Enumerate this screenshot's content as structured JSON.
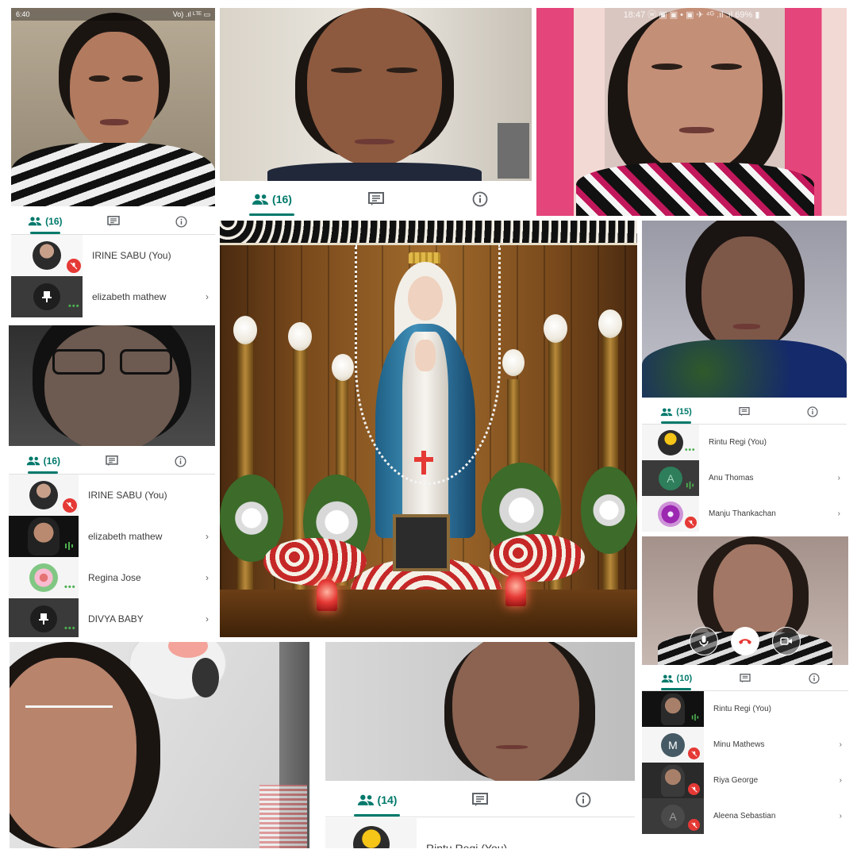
{
  "tile1": {
    "status_time": "6:40",
    "status_right": "Vo) .ıl ᴸᵀᴱ ▭",
    "participants_count": "(16)",
    "participants": [
      {
        "name": "IRINE SABU (You)",
        "muted": true
      },
      {
        "name": "elizabeth mathew",
        "muted": false
      }
    ]
  },
  "tile2": {
    "participants_count": "(16)"
  },
  "tile3": {
    "status_text": "18:47 ⓦ ▣ ▣ •   ▣ ✈ ⁴ᴳ .ıl .ıl 69% ▮"
  },
  "tile4": {
    "participants_count": "(16)",
    "participants": [
      {
        "name": "IRINE SABU (You)",
        "muted": true
      },
      {
        "name": "elizabeth mathew",
        "muted": false
      },
      {
        "name": "Regina Jose",
        "muted": false
      },
      {
        "name": "DIVYA BABY",
        "muted": false
      }
    ]
  },
  "tile6": {
    "participants_count": "(15)",
    "participants": [
      {
        "name": "Rintu Regi (You)",
        "avatar": ""
      },
      {
        "name": "Anu Thomas",
        "avatar": "A"
      },
      {
        "name": "Manju Thankachan",
        "avatar": ""
      }
    ]
  },
  "tile7": {
    "participants_count": "(10)",
    "participants": [
      {
        "name": "Rintu Regi (You)",
        "avatar": ""
      },
      {
        "name": "Minu Mathews",
        "avatar": "M"
      },
      {
        "name": "Riya George",
        "avatar": ""
      },
      {
        "name": "Aleena Sebastian",
        "avatar": "A"
      }
    ]
  },
  "tile9": {
    "participants_count": "(14)",
    "participants": [
      {
        "name": "Rintu Regi (You)"
      }
    ]
  },
  "colors": {
    "accent": "#00796b",
    "mute_red": "#e53935",
    "hangup": "#ffffff",
    "talk_green": "#4caf50"
  },
  "icons": {
    "people": "people-icon",
    "chat": "chat-icon",
    "info": "info-icon",
    "mic_off": "mic-off-icon",
    "pin": "pin-icon",
    "mic": "mic-icon",
    "hangup": "hangup-icon",
    "camera": "camera-icon",
    "chevron": "chevron-right-icon"
  }
}
